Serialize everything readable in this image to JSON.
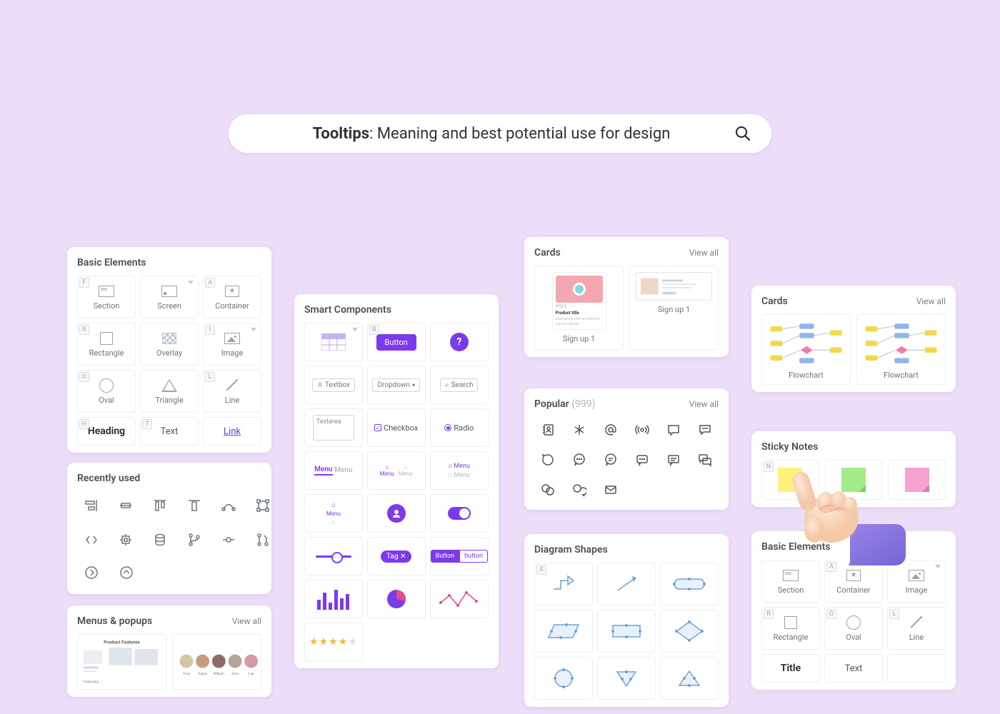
{
  "hero": {
    "bold": "Tooltips",
    "rest": ": Meaning and best potential use for design"
  },
  "basic_elements": {
    "title": "Basic Elements",
    "items": [
      {
        "label": "Section",
        "key": "F"
      },
      {
        "label": "Screen",
        "key": ""
      },
      {
        "label": "Container",
        "key": "A"
      },
      {
        "label": "Rectangle",
        "key": "R"
      },
      {
        "label": "Overlay",
        "key": ""
      },
      {
        "label": "Image",
        "key": "I"
      },
      {
        "label": "Oval",
        "key": "O"
      },
      {
        "label": "Triangle",
        "key": ""
      },
      {
        "label": "Line",
        "key": "L"
      }
    ],
    "bottom": [
      {
        "label": "Heading",
        "key": "H"
      },
      {
        "label": "Text",
        "key": "T"
      },
      {
        "label": "Link",
        "key": ""
      }
    ]
  },
  "recent": {
    "title": "Recently used"
  },
  "menus": {
    "title": "Menus & popups",
    "view_all": "View all",
    "thumb1": "Product Features"
  },
  "smart": {
    "title": "Smart Components",
    "key_b": "B",
    "button": "Button",
    "textbox": "Textbox",
    "dropdown": "Dropdown",
    "search": "Search",
    "textarea": "Textarea",
    "checkbox": "Checkbox",
    "radio": "Radio",
    "menu": "Menu",
    "tag": "Tag ✕",
    "btn_primary": "Button",
    "btn_secondary": "button"
  },
  "cards1": {
    "title": "Cards",
    "view_all": "View all",
    "c1": "Sign up 1",
    "c2": "Sign up 1",
    "pill": "Product title"
  },
  "popular": {
    "title": "Popular",
    "count": "(999)",
    "view_all": "View all"
  },
  "diagram": {
    "title": "Diagram Shapes",
    "key": "X"
  },
  "cards2": {
    "title": "Cards",
    "view_all": "View all",
    "c1": "Flowchart",
    "c2": "Flowchart"
  },
  "sticky": {
    "title": "Sticky Notes",
    "key": "N"
  },
  "basic2": {
    "title": "Basic Elements",
    "items": [
      {
        "label": "Section",
        "key": ""
      },
      {
        "label": "Container",
        "key": "A"
      },
      {
        "label": "Image",
        "key": ""
      },
      {
        "label": "Rectangle",
        "key": "R"
      },
      {
        "label": "Oval",
        "key": "O"
      },
      {
        "label": "Line",
        "key": "L"
      }
    ],
    "title_lbl": "Title",
    "text_lbl": "Text"
  }
}
